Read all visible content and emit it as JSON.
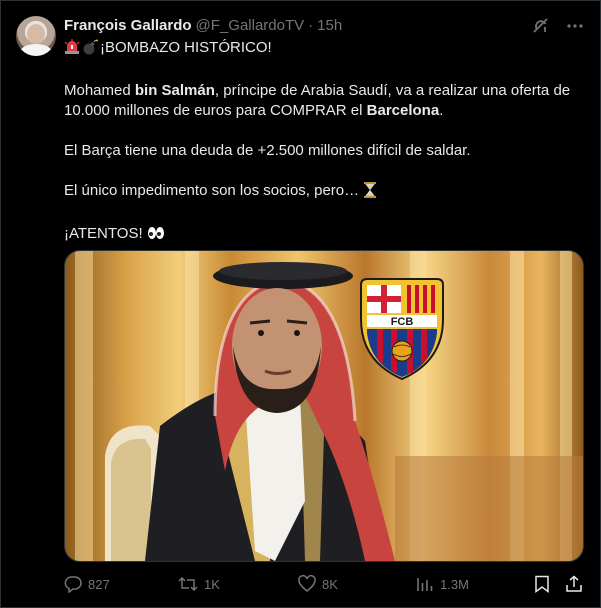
{
  "tweet": {
    "author_name": "François Gallardo",
    "author_handle": "@F_GallardoTV",
    "separator": "·",
    "time": "15h",
    "line1": "¡BOMBAZO HISTÓRICO!",
    "p1_a": "Mohamed ",
    "p1_b": "bin Salmán",
    "p1_c": ", príncipe de Arabia Saudí, va a realizar una oferta de 10.000 millones de euros para COMPRAR el ",
    "p1_d": "Barcelona",
    "p1_e": ".",
    "p2": "El Barça tiene una deuda de +2.500 millones difícil de saldar.",
    "p3": "El único impedimento son los socios, pero… ",
    "p4": "¡ATENTOS! ",
    "crest_text": "FCB"
  },
  "stats": {
    "replies": "827",
    "retweets": "1K",
    "likes": "8K",
    "views": "1.3M"
  },
  "icons": {
    "header": [
      "grok-icon",
      "more-icon"
    ],
    "content": [
      "siren-emoji",
      "bomb-emoji",
      "hourglass-emoji",
      "eyes-emoji"
    ],
    "actions": [
      "reply-icon",
      "retweet-icon",
      "like-icon",
      "views-icon",
      "bookmark-icon",
      "share-icon"
    ]
  },
  "colors": {
    "background": "#000000",
    "text": "#e7e9ea",
    "muted": "#71767b",
    "border": "#2f3336"
  }
}
